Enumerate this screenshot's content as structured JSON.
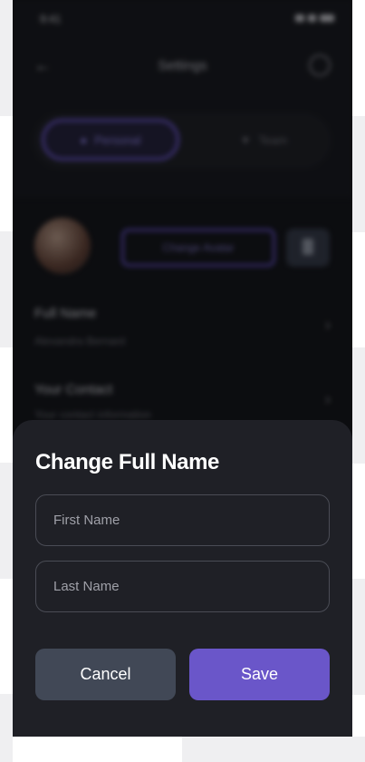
{
  "status_bar": {
    "time": "9:41"
  },
  "header": {
    "title": "Settings",
    "back_icon": "arrow-left-icon",
    "help_icon": "help-circle-icon"
  },
  "tabs": [
    {
      "label": "Personal",
      "icon": "person-icon",
      "active": true
    },
    {
      "label": "Team",
      "icon": "shield-icon",
      "active": false
    }
  ],
  "profile": {
    "change_avatar_label": "Change Avatar",
    "delete_icon": "trash-icon"
  },
  "rows": [
    {
      "title": "Full Name",
      "subtitle": "Alexandra Bernard"
    },
    {
      "title": "Your Contact",
      "subtitle": "Your contact information"
    }
  ],
  "sheet": {
    "title": "Change Full Name",
    "first_name_placeholder": "First Name",
    "last_name_placeholder": "Last Name",
    "cancel_label": "Cancel",
    "save_label": "Save"
  },
  "colors": {
    "accent": "#6a56c9",
    "sheet_bg": "#1f2026",
    "cancel_bg": "#414856"
  }
}
